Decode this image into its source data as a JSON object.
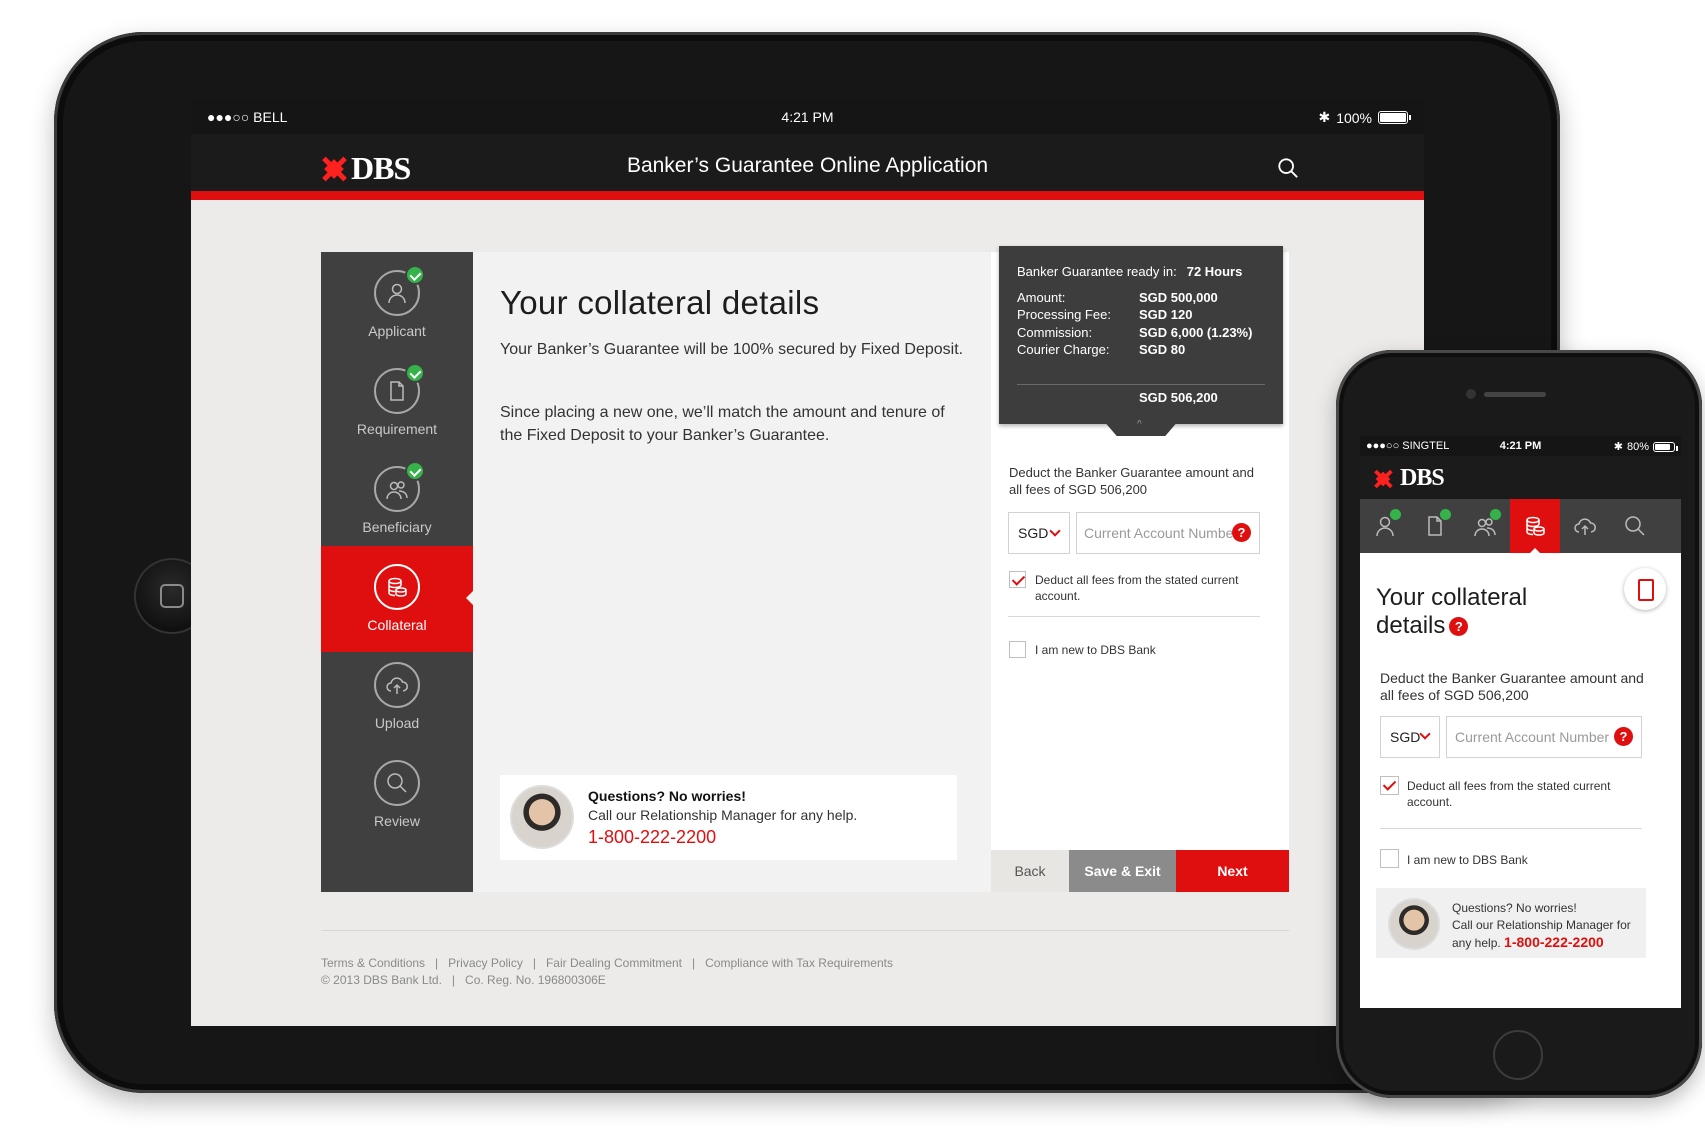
{
  "ipad": {
    "status": {
      "carrier": "●●●○○ BELL",
      "time": "4:21 PM",
      "battery": "100%"
    },
    "header": {
      "logo": "DBS",
      "title": "Banker’s Guarantee Online Application"
    },
    "nav": [
      {
        "label": "Applicant",
        "done": true
      },
      {
        "label": "Requirement",
        "done": true
      },
      {
        "label": "Beneficiary",
        "done": true
      },
      {
        "label": "Collateral",
        "active": true
      },
      {
        "label": "Upload"
      },
      {
        "label": "Review"
      }
    ],
    "main": {
      "title": "Your collateral details",
      "para1": "Your Banker’s Guarantee will be 100% secured by Fixed Deposit.",
      "para2": "Since placing a new one, we’ll match the amount and tenure of the Fixed Deposit to your Banker’s Guarantee."
    },
    "help": {
      "question": "Questions? No worries!",
      "call": "Call our Relationship Manager for any help.",
      "phone": "1-800-222-2200"
    },
    "summary": {
      "ready_label": "Banker Guarantee ready in:",
      "ready_value": "72 Hours",
      "rows": [
        {
          "k": "Amount:",
          "v": "SGD 500,000"
        },
        {
          "k": "Processing Fee:",
          "v": "SGD 120"
        },
        {
          "k": "Commission:",
          "v": "SGD 6,000 (1.23%)"
        },
        {
          "k": "Courier Charge:",
          "v": "SGD 80"
        }
      ],
      "total": "SGD 506,200"
    },
    "form": {
      "deduct_text": "Deduct the Banker Guarantee amount and all fees of SGD 506,200",
      "currency": "SGD",
      "account_placeholder": "Current Account Number",
      "cb1": "Deduct all fees from the stated current account.",
      "cb2": "I am new to DBS Bank"
    },
    "buttons": {
      "back": "Back",
      "save": "Save & Exit",
      "next": "Next"
    },
    "footer": {
      "links": "Terms & Conditions   |   Privacy Policy   |   Fair Dealing Commitment   |   Compliance with Tax Requirements",
      "copyright": "© 2013 DBS Bank Ltd.   |   Co. Reg. No. 196800306E"
    }
  },
  "iphone": {
    "status": {
      "carrier": "●●●○○ SINGTEL",
      "time": "4:21 PM",
      "battery": "80%"
    },
    "logo": "DBS",
    "title": "Your collateral details",
    "help_mark": "?",
    "deduct_text": "Deduct the Banker Guarantee amount and all fees of SGD 506,200",
    "currency": "SGD",
    "account_placeholder": "Current Account Number",
    "cb1": "Deduct all fees from the stated current account.",
    "cb2": "I am new to DBS Bank",
    "help_q": "Questions? No worries!",
    "help_c": "Call our Relationship Manager for any help.",
    "phone": "1-800-222-2200"
  },
  "colors": {
    "brand_red": "#e00f0f",
    "dark": "#1b1b1b",
    "nav": "#404040",
    "check": "#35b34a"
  }
}
